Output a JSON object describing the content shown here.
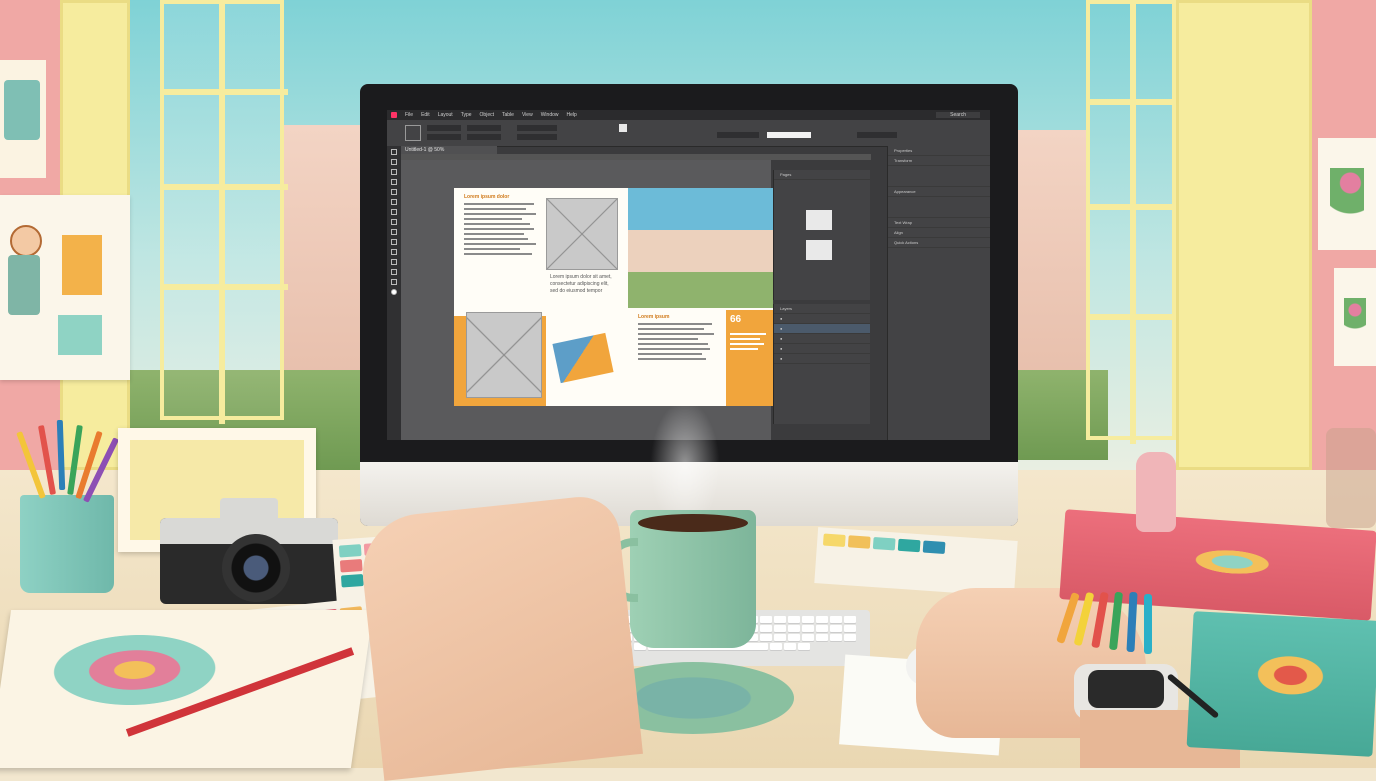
{
  "app": {
    "name": "Adobe InDesign",
    "document_tab": "Untitled-1 @ 50%",
    "menus": [
      "File",
      "Edit",
      "Layout",
      "Type",
      "Object",
      "Table",
      "View",
      "Window",
      "Help"
    ],
    "workspace_search_placeholder": "Search"
  },
  "panels": {
    "pages_title": "Pages",
    "properties_title": "Properties",
    "sections": [
      "Transform",
      "Appearance",
      "Text Wrap",
      "Align",
      "Quick Actions",
      "Layers"
    ],
    "layer_count": 5
  },
  "layout": {
    "left_page_heading": "Lorem ipsum dolor",
    "left_callout": "Lorem ipsum dolor sit amet, consectetur adipiscing elit, sed do eiusmod tempor",
    "right_heading": "Lorem ipsum",
    "right_box_mark": "66"
  },
  "colors": {
    "accent_orange": "#f1a53c",
    "ui_dark": "#3b3b3d",
    "wall_pink": "#f0a8a5",
    "window_yellow": "#f6ec9e",
    "mug_green": "#8ac0a0"
  },
  "icons": [
    "move-tool-icon",
    "type-tool-icon",
    "rectangle-tool-icon",
    "hand-tool-icon",
    "zoom-tool-icon",
    "eye-icon",
    "layer-icon"
  ]
}
